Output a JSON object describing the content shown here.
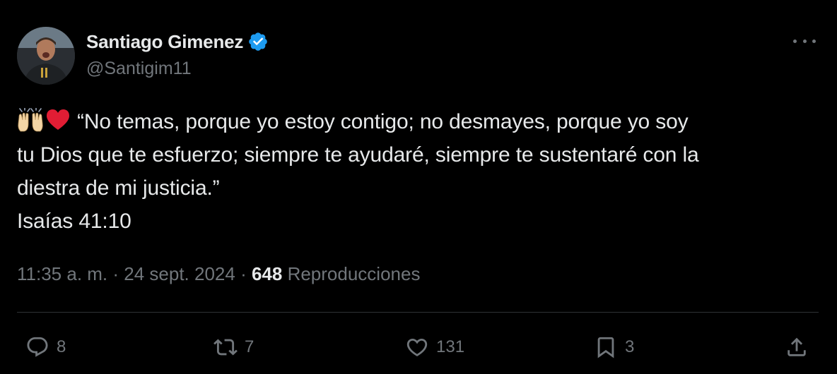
{
  "author": {
    "display_name": "Santiago Gimenez",
    "handle": "@Santigim11",
    "verified": true
  },
  "tweet": {
    "text": "“No temas, porque yo estoy contigo; no desmayes, porque yo soy\ntu Dios que te esfuerzo; siempre te ayudaré, siempre te sustentaré con la\ndiestra de mi justicia.”\nIsaías 41:10",
    "emojis": [
      "raising-hands-icon",
      "red-heart-icon"
    ]
  },
  "meta": {
    "time": "11:35 a. m.",
    "separator": " · ",
    "date": "24 sept. 2024",
    "views_count": "648",
    "views_label": " Reproducciones"
  },
  "actions": {
    "replies": "8",
    "reposts": "7",
    "likes": "131",
    "bookmarks": "3"
  },
  "colors": {
    "background": "#000000",
    "text": "#e7e9ea",
    "secondary": "#71767b",
    "verified": "#1d9bf0",
    "divider": "#2f3336",
    "heart": "#e11d34"
  }
}
